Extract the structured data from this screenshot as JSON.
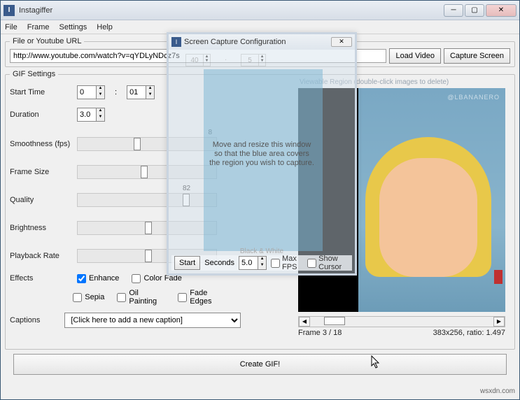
{
  "window": {
    "title": "Instagiffer"
  },
  "menu": {
    "file": "File",
    "frame": "Frame",
    "settings": "Settings",
    "help": "Help"
  },
  "url_group": {
    "legend": "File or Youtube URL",
    "url": "http://www.youtube.com/watch?v=qYDLyNDcz7s",
    "load": "Load Video",
    "capture": "Capture Screen"
  },
  "gif": {
    "legend": "GIF Settings",
    "start_time": "Start Time",
    "start_min": "0",
    "start_sec": "01",
    "duration_lbl": "Duration",
    "duration": "3.0",
    "smoothness_lbl": "Smoothness (fps)",
    "smooth_val": "8",
    "frame_size_lbl": "Frame Size",
    "quality_lbl": "Quality",
    "quality_val": "82",
    "brightness_lbl": "Brightness",
    "playback_lbl": "Playback Rate",
    "effects_lbl": "Effects",
    "enhance": "Enhance",
    "colorfade": "Color Fade",
    "sepia": "Sepia",
    "oil": "Oil Painting",
    "fadeedges": "Fade Edges",
    "captions_lbl": "Captions",
    "caption_ph": "[Click here to add a new caption]"
  },
  "preview": {
    "viewable": "Viewable Region (double-click images to delete)",
    "watermark": "@LBANANERO",
    "frame_status": "Frame  3 / 18",
    "dims": "383x256, ratio:  1.497"
  },
  "create": "Create GIF!",
  "dialog": {
    "title": "Screen Capture Configuration",
    "ghost_a": "40",
    "ghost_b": "5",
    "msg1": "Move and resize this window",
    "msg2": "so that the blue area covers",
    "msg3": "the region you wish to capture.",
    "start": "Start",
    "seconds": "Seconds",
    "secval": "5.0",
    "maxfps": "Max FPS",
    "showcursor": "Show Cursor",
    "bw": "Black & White"
  },
  "footer": "wsxdn.com"
}
